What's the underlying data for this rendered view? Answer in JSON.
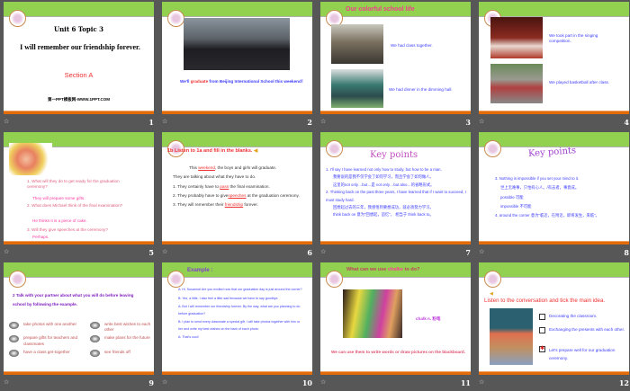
{
  "slides": [
    {
      "num": "1",
      "unit": "Unit 6  Topic 3",
      "title": "I will remember  our friendship forever.",
      "section": "Section A",
      "footer": "第一PPT模板网-WWW.1PPT.COM"
    },
    {
      "num": "2",
      "caption_a": "We'll ",
      "caption_red": "graduate",
      "caption_b": " from Beijing International School this weekend！"
    },
    {
      "num": "3",
      "title": "Our colorful school life",
      "cap1": "We had class together.",
      "cap2": "We had dinner in the dimming hall."
    },
    {
      "num": "4",
      "cap1": "We took part in the singing competition.",
      "cap2": "We played basketball after class."
    },
    {
      "num": "5",
      "q1": "1. What will they do to get ready for the graduation ceremony?",
      "a1": "They will prepare some gifts.",
      "q2": "2. What does Michael think of the final examination?",
      "a2": "He thinks it is a piece of cake.",
      "q3": "3. Will they give speeches at the ceremony?",
      "a3": "Perhaps."
    },
    {
      "num": "6",
      "badge": "1b",
      "title": "Listen to 1a and fill in the blanks.",
      "l1a": "This ",
      "b1": "weekend",
      "l1b": ", the boys and girls will graduate.",
      "l2": "They are talking about what they have to do.",
      "l3a": "1. They certainly have to ",
      "b3": "pass",
      "l3b": " the final examination.",
      "l4a": "2. They probably have to give",
      "b4": "speeches",
      "l4b": " at the graduation ceremony.",
      "l5a": "3. They will remember their ",
      "b5": "friendship",
      "l5b": " forever."
    },
    {
      "num": "7",
      "title": "Key points",
      "lines": [
        "1.  I'll say I have learned not only how to study, but how to be a man.",
        "我要说的是我不仅学会了如何学习，而且学会了如何做人。",
        "这里的not only…but…是 not only…but also…的省略形式。",
        "2. Thinking back on the past three years, I have learned that if I want to succeed, I must study hard.",
        "回想起过去的三年，我感悟到要想成功，就必须努力学习。",
        "think back on  意为“回想起，追忆”，  相当于 think back to。"
      ]
    },
    {
      "num": "8",
      "title": "Key points",
      "lines": [
        "3. Nothing is impossible if you set your mind to it.",
        "世上无难事，只怕有心人。/有志者，事竟成。",
        "possible  可能",
        "impossible  不可能",
        "4. around the corner  意为“临近，在附近，即将发生，来临”。"
      ]
    },
    {
      "num": "9",
      "title": "2  Talk with your partner about what you will do before leaving school by following the example.",
      "items": [
        "take photos with one another",
        "prepare gifts for teachers and classmates",
        "have a class get-together",
        "write best wishes to each other",
        "make plans for the future",
        "see friends off"
      ]
    },
    {
      "num": "10",
      "title": "Example :",
      "lines": [
        "A: Hi, Susanna!  Are you excited  now  that our graduation  day  is just around  the  corner?",
        "B: Yes, a little. I also feel a little sad because  we have to say goodbye.",
        "A: But I will remember  our friendship  forever.  By the way,  what are you  planning  to do before  graduation?",
        "B: I plan to send every  classmate  a special gift. I will take  photos together with him or her and write my best wishes  on the back of each photo.",
        "A: That's cool!"
      ]
    },
    {
      "num": "11",
      "title_a": "What can we use ",
      "title_b": "chalks",
      "title_c": " to do?",
      "chalk": "chalk    n. 粉笔",
      "caption": "We can use them to write words or draw pictures on the blackboard."
    },
    {
      "num": "12",
      "title": "Listen to the conversation and tick the main idea.",
      "options": [
        {
          "label": "Decorating the classroom.",
          "checked": false
        },
        {
          "label": "Exchanging the presents with each other.",
          "checked": false
        },
        {
          "label": "Let's prepare well for our graduation ceremony.",
          "checked": true
        }
      ]
    }
  ],
  "star": "☆"
}
